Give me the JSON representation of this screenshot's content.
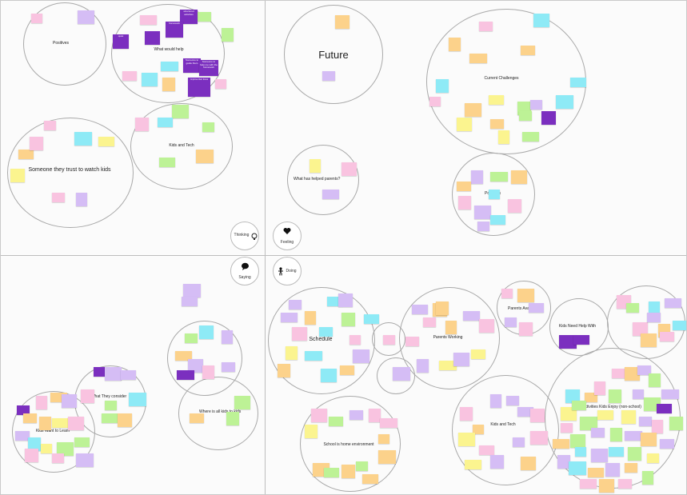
{
  "quadrant_titles": {
    "future": "Future",
    "schedule": "Schedule"
  },
  "moods": {
    "thinking": "Thinking",
    "feeling": "Feeling",
    "saying": "Saying",
    "doing": "Doing"
  },
  "clusters": {
    "positives_left": "Positives",
    "what_would_help": "What would help",
    "someone_trust": "Someone they trust to watch kids",
    "kids_tech_top": "Kids and Tech",
    "what_parents": "What has helped parents?",
    "current_challenges": "Current Challenges",
    "positives_right": "Positives",
    "what_they_consider": "What They consider",
    "kids_want_learn": "Kids Want to Learn",
    "where_all_kids": "Where is all kids to kids",
    "parents_working": "Parents Working",
    "kids_tech_bottom": "Kids and Tech",
    "school_home": "School is home environment",
    "kids_need_help": "Kids Need Help With",
    "activities": "Activities Kids Enjoy (non-school)",
    "parents_availability": "Parents Availability"
  },
  "sticky_texts": {
    "s1": "structured activities",
    "s2": "Someone to guide them",
    "s3": "Someone to help me with the homework",
    "s4": "Someone to help me with the hardwork",
    "s5": "Improve their focus",
    "s6": "quiet",
    "s7": "homework"
  },
  "colors": {
    "pink": "#f9c3e0",
    "purple": "#7b2fbf",
    "lavender": "#d5bdf5",
    "orange": "#fcd28b",
    "yellow": "#fbf48f",
    "green": "#bdf296",
    "cyan": "#8eeaf6"
  }
}
